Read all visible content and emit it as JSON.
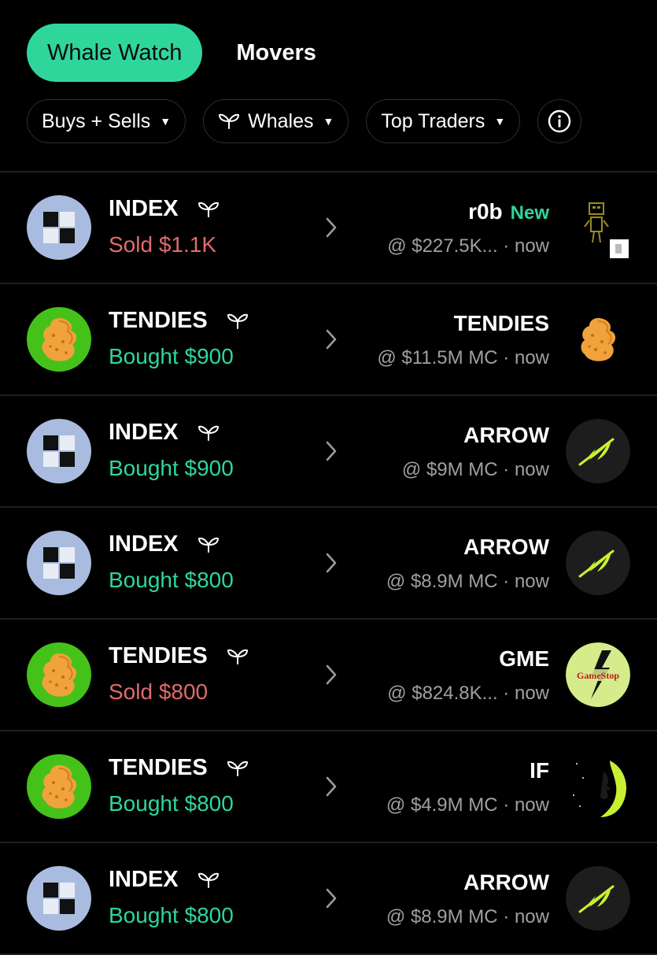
{
  "tabs": {
    "active": "Whale Watch",
    "inactive": "Movers"
  },
  "filters": [
    {
      "label": "Buys + Sells",
      "icon": ""
    },
    {
      "label": "Whales",
      "icon": "whale-tail-icon"
    },
    {
      "label": "Top Traders",
      "icon": ""
    }
  ],
  "rows": [
    {
      "trader": "INDEX",
      "action": "Sold $1.1K",
      "side": "sold",
      "token": "r0b",
      "tag": "New",
      "mc": "@ $227.5K... · now",
      "trader_icon": "index-icon",
      "token_icon": "r0b-robot-icon"
    },
    {
      "trader": "TENDIES",
      "action": "Bought $900",
      "side": "bought",
      "token": "TENDIES",
      "tag": "",
      "mc": "@ $11.5M MC · now",
      "trader_icon": "tendies-icon",
      "token_icon": "tendies-icon"
    },
    {
      "trader": "INDEX",
      "action": "Bought $900",
      "side": "bought",
      "token": "ARROW",
      "tag": "",
      "mc": "@ $9M MC · now",
      "trader_icon": "index-icon",
      "token_icon": "arrow-leaf-icon"
    },
    {
      "trader": "INDEX",
      "action": "Bought $800",
      "side": "bought",
      "token": "ARROW",
      "tag": "",
      "mc": "@ $8.9M MC · now",
      "trader_icon": "index-icon",
      "token_icon": "arrow-leaf-icon"
    },
    {
      "trader": "TENDIES",
      "action": "Sold $800",
      "side": "sold",
      "token": "GME",
      "tag": "",
      "mc": "@ $824.8K... · now",
      "trader_icon": "tendies-icon",
      "token_icon": "gamestop-icon"
    },
    {
      "trader": "TENDIES",
      "action": "Bought $800",
      "side": "bought",
      "token": "IF",
      "tag": "",
      "mc": "@ $4.9M MC · now",
      "trader_icon": "tendies-icon",
      "token_icon": "if-moon-icon"
    },
    {
      "trader": "INDEX",
      "action": "Bought $800",
      "side": "bought",
      "token": "ARROW",
      "tag": "",
      "mc": "@ $8.9M MC · now",
      "trader_icon": "index-icon",
      "token_icon": "arrow-leaf-icon"
    }
  ],
  "gamestop_logo_text": "GameStop",
  "colors": {
    "accent": "#2fd69c",
    "sold": "#e06b6b",
    "bought": "#2fd69c",
    "background": "#000000"
  }
}
